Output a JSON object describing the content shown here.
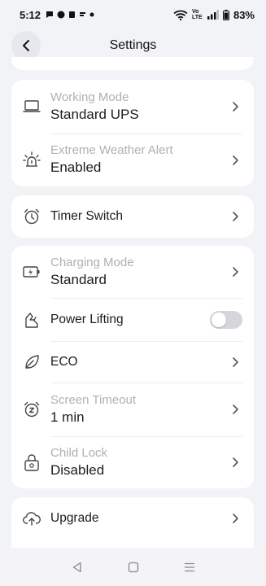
{
  "status_bar": {
    "time": "5:12",
    "network_label": "Vo LTE",
    "battery": "83%"
  },
  "header": {
    "title": "Settings"
  },
  "groups": {
    "mode": {
      "working_mode": {
        "label": "Working Mode",
        "value": "Standard UPS",
        "icon": "laptop-icon"
      },
      "weather_alert": {
        "label": "Extreme Weather Alert",
        "value": "Enabled",
        "icon": "weather-alert-icon"
      }
    },
    "timer": {
      "timer_switch": {
        "label": "Timer Switch",
        "icon": "alarm-clock-icon"
      }
    },
    "power": {
      "charging_mode": {
        "label": "Charging Mode",
        "value": "Standard",
        "icon": "battery-charging-icon"
      },
      "power_lifting": {
        "label": "Power Lifting",
        "enabled": false,
        "icon": "power-lifting-icon"
      },
      "eco": {
        "label": "ECO",
        "icon": "leaf-icon"
      },
      "screen_timeout": {
        "label": "Screen Timeout",
        "value": "1 min",
        "icon": "sleep-clock-icon"
      },
      "child_lock": {
        "label": "Child Lock",
        "value": "Disabled",
        "icon": "lock-icon"
      }
    },
    "upgrade": {
      "upgrade": {
        "label": "Upgrade",
        "icon": "cloud-upload-icon"
      }
    }
  },
  "colors": {
    "background": "#f2f3f7",
    "card": "#ffffff",
    "secondary_text": "#b0b0b5",
    "primary_text": "#1c1c1e",
    "toggle_off": "#d5d6da"
  }
}
